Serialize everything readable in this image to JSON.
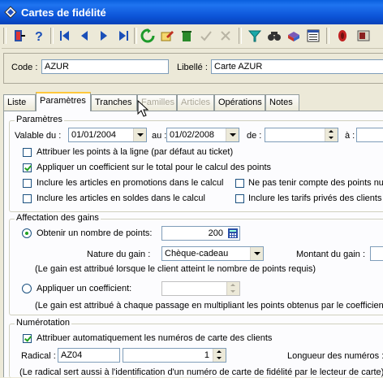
{
  "window": {
    "title": "Cartes de fidélité"
  },
  "toolbar": {
    "icons": [
      "door-exit-icon",
      "help-icon",
      "first-icon",
      "previous-icon",
      "next-icon",
      "last-icon",
      "refresh-icon",
      "edit-icon",
      "delete-icon",
      "validate-icon",
      "cancel-icon",
      "filter-icon",
      "search-icon",
      "print-icon",
      "list-icon",
      "record-icon",
      "close-icon"
    ]
  },
  "header": {
    "code_label": "Code :",
    "code_value": "AZUR",
    "libelle_label": "Libellé :",
    "libelle_value": "Carte AZUR"
  },
  "tabs": [
    {
      "label": "Liste",
      "state": "normal"
    },
    {
      "label": "Paramètres",
      "state": "active"
    },
    {
      "label": "Tranches",
      "state": "normal"
    },
    {
      "label": "Familles",
      "state": "disabled"
    },
    {
      "label": "Articles",
      "state": "disabled"
    },
    {
      "label": "Opérations",
      "state": "normal"
    },
    {
      "label": "Notes",
      "state": "normal"
    }
  ],
  "parametres": {
    "title": "Paramètres",
    "valable_du_label": "Valable du :",
    "valable_du_value": "01/01/2004",
    "au_label": "au :",
    "au_value": "01/02/2008",
    "de_label": "de :",
    "de_value": "",
    "a_label": "à :",
    "checkboxes": [
      {
        "label": "Attribuer les points à la ligne (par défaut au ticket)",
        "checked": false
      },
      {
        "label": "Appliquer un coefficient sur le total pour le calcul des points",
        "checked": true
      },
      {
        "label": "Inclure les articles en promotions dans le calcul",
        "checked": false
      },
      {
        "label": "Ne pas tenir compte des points nuls s",
        "checked": false
      },
      {
        "label": "Inclure les articles en soldes dans le calcul",
        "checked": false
      },
      {
        "label": "Inclure les tarifs privés des clients da",
        "checked": false
      }
    ]
  },
  "affectation": {
    "title": "Affectation des gains",
    "points_radio_label": "Obtenir un nombre de points:",
    "points_value": "200",
    "nature_label": "Nature du gain :",
    "nature_value": "Chèque-cadeau",
    "montant_label": "Montant du gain :",
    "points_note": "(Le gain est attribué lorsque le client atteint le nombre de points requis)",
    "coef_radio_label": "Appliquer un coefficient:",
    "coef_value": "",
    "coef_note": "(Le gain est attribué à chaque passage en multipliant les points obtenus par le coefficient)"
  },
  "numerotation": {
    "title": "Numérotation",
    "auto_label": "Attribuer automatiquement les numéros de carte des clients",
    "auto_checked": true,
    "radical_label": "Radical :",
    "radical_value": "AZ04",
    "counter_value": "1",
    "longueur_label": "Longueur des numéros :",
    "note": "(Le radical sert aussi à l'identification d'un numéro de carte de fidélité par le lecteur de carte)"
  },
  "colors": {
    "title_bar": "#0b52d6",
    "active_tab_accent": "#ffc83c",
    "check_green": "#21a121"
  }
}
